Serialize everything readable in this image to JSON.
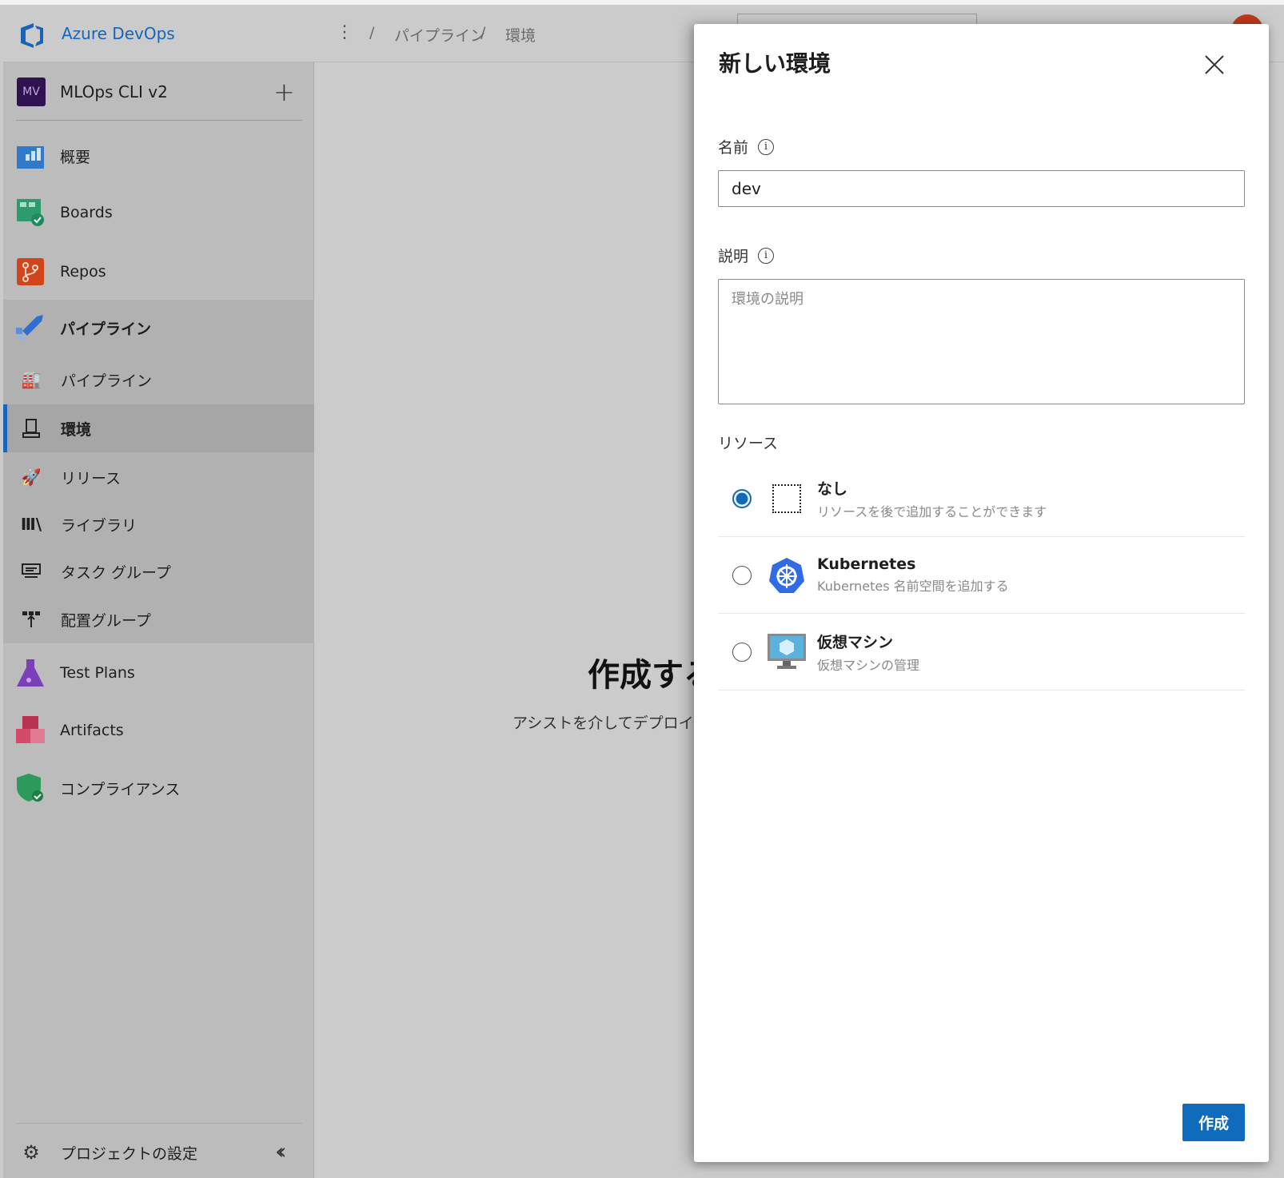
{
  "header": {
    "brand": "Azure DevOps",
    "breadcrumb": [
      "パイプライン",
      "環境"
    ],
    "separator": "/"
  },
  "project": {
    "initials": "MV",
    "name": "MLOps CLI v2",
    "avatar_color": "#2e1350"
  },
  "sidebar": {
    "items": [
      {
        "label": "概要",
        "icon": "overview-icon"
      },
      {
        "label": "Boards",
        "icon": "boards-icon"
      },
      {
        "label": "Repos",
        "icon": "repos-icon"
      },
      {
        "label": "パイプライン",
        "icon": "pipelines-icon"
      },
      {
        "label": "Test Plans",
        "icon": "test-plans-icon"
      },
      {
        "label": "Artifacts",
        "icon": "artifacts-icon"
      },
      {
        "label": "コンプライアンス",
        "icon": "compliance-icon"
      }
    ],
    "sub_items": [
      {
        "label": "パイプライン",
        "icon": "pipeline-factory-icon"
      },
      {
        "label": "環境",
        "icon": "environment-icon",
        "selected": true
      },
      {
        "label": "リリース",
        "icon": "rocket-icon"
      },
      {
        "label": "ライブラリ",
        "icon": "library-icon"
      },
      {
        "label": "タスク グループ",
        "icon": "task-group-icon"
      },
      {
        "label": "配置グループ",
        "icon": "deployment-group-icon"
      }
    ],
    "settings": "プロジェクトの設定"
  },
  "main": {
    "title": "作成する",
    "subtitle": "アシストを介してデプロイを管"
  },
  "panel": {
    "title": "新しい環境",
    "name_label": "名前",
    "name_value": "dev",
    "desc_label": "説明",
    "desc_placeholder": "環境の説明",
    "resource_label": "リソース",
    "options": [
      {
        "title": "なし",
        "desc": "リソースを後で追加することができます",
        "selected": true
      },
      {
        "title": "Kubernetes",
        "desc": "Kubernetes 名前空間を追加する",
        "selected": false
      },
      {
        "title": "仮想マシン",
        "desc": "仮想マシンの管理",
        "selected": false
      }
    ],
    "create": "作成"
  },
  "colors": {
    "accent": "#0f6cbd",
    "brand": "#1764b8"
  }
}
